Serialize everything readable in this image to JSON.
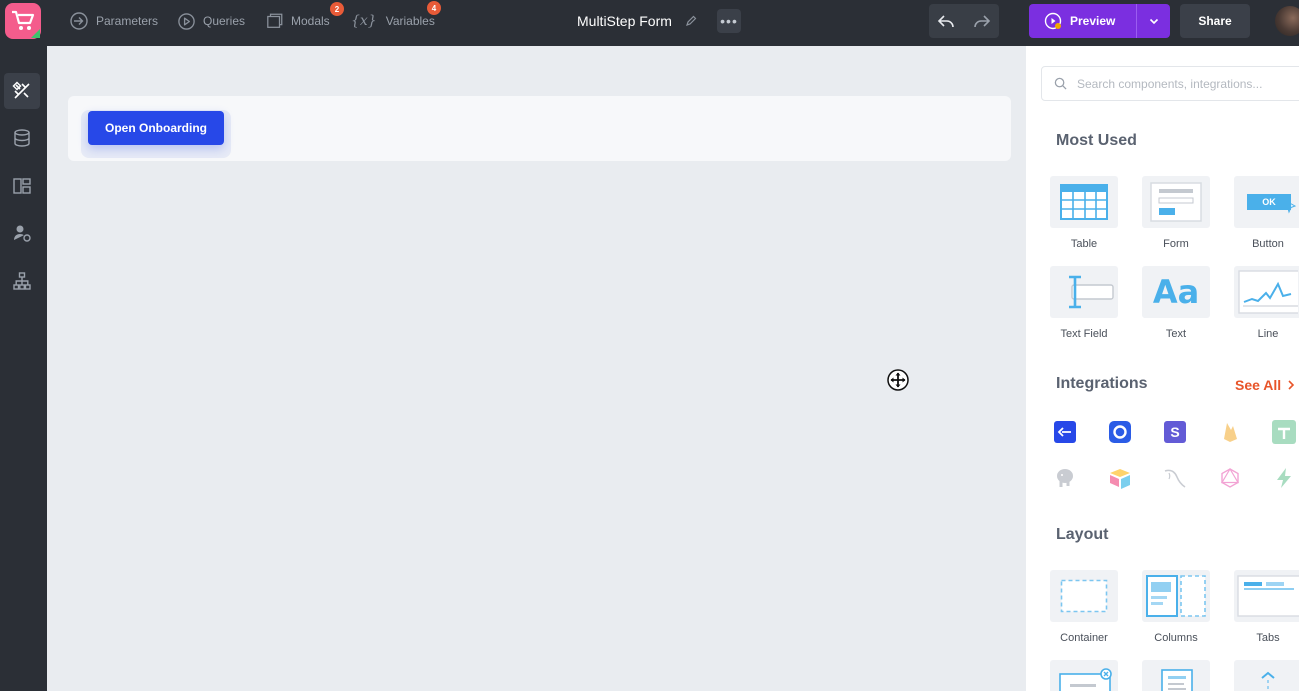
{
  "topbar": {
    "nav": [
      {
        "label": "Parameters",
        "icon": "parameters-icon"
      },
      {
        "label": "Queries",
        "icon": "play-circle-icon"
      },
      {
        "label": "Modals",
        "icon": "modals-icon",
        "badge": "2"
      },
      {
        "label": "Variables",
        "icon": "variables-icon",
        "badge": "4"
      }
    ],
    "variables_icon_text": "{x}",
    "document_title": "MultiStep Form",
    "more_glyph": "•••",
    "preview_label": "Preview",
    "share_label": "Share"
  },
  "rail": {
    "items": [
      {
        "name": "design-icon",
        "active": true
      },
      {
        "name": "database-icon",
        "active": false
      },
      {
        "name": "layout-icon",
        "active": false
      },
      {
        "name": "user-settings-icon",
        "active": false
      },
      {
        "name": "hierarchy-icon",
        "active": false
      }
    ]
  },
  "canvas": {
    "open_button_label": "Open Onboarding"
  },
  "panel": {
    "search_placeholder": "Search components, integrations...",
    "most_used_title": "Most Used",
    "most_used": [
      {
        "label": "Table"
      },
      {
        "label": "Form"
      },
      {
        "label": "Button",
        "glyph": "OK"
      },
      {
        "label": "Text Field"
      },
      {
        "label": "Text",
        "glyph": "Aa"
      },
      {
        "label": "Line"
      }
    ],
    "integrations_title": "Integrations",
    "see_all_label": "See All",
    "integrations": [
      "api-icon",
      "onboarding-icon",
      "stripe-icon",
      "firebase-icon",
      "google-sheets-icon",
      "postgres-icon",
      "airtable-icon",
      "mysql-icon",
      "graphql-icon",
      "zapier-icon"
    ],
    "stripe_glyph": "S",
    "layout_title": "Layout",
    "layout": [
      {
        "label": "Container"
      },
      {
        "label": "Columns"
      },
      {
        "label": "Tabs"
      }
    ]
  },
  "colors": {
    "topbar_bg": "#2b2f36",
    "accent_purple": "#7b2fe0",
    "primary_blue": "#2748e8",
    "link_orange": "#e8552a",
    "badge_orange": "#e85b38",
    "icon_blue": "#4ab0ea"
  }
}
